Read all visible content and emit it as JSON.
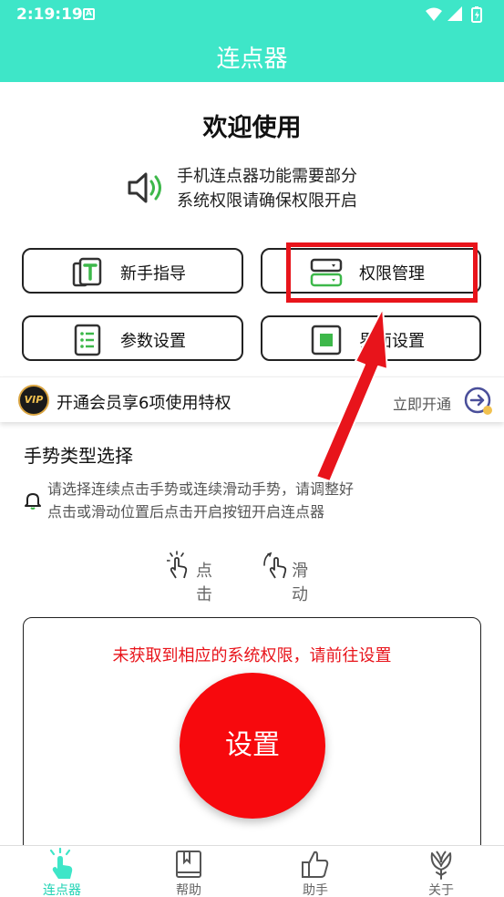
{
  "status": {
    "time": "2:19:19",
    "notif_glyph": "A"
  },
  "header": {
    "title": "连点器"
  },
  "welcome": "欢迎使用",
  "notice": {
    "line1": "手机连点器功能需要部分",
    "line2": "系统权限请确保权限开启"
  },
  "buttons": [
    {
      "label": "新手指导",
      "icon": "guide-icon"
    },
    {
      "label": "权限管理",
      "icon": "permission-icon"
    },
    {
      "label": "参数设置",
      "icon": "list-icon"
    },
    {
      "label": "界面设置",
      "icon": "interface-icon"
    }
  ],
  "vip": {
    "badge": "VIP",
    "text": "开通会员享6项使用特权",
    "action": "立即开通"
  },
  "gesture": {
    "title": "手势类型选择",
    "hint_line1": "请选择连续点击手势或连续滑动手势，请调整好",
    "hint_line2": "点击或滑动位置后点击开启按钮开启连点器",
    "tap_label": "点击",
    "swipe_label": "滑动"
  },
  "panel": {
    "warning": "未获取到相应的系统权限，请前往设置",
    "button": "设置"
  },
  "tabs": [
    {
      "label": "连点器",
      "active": true
    },
    {
      "label": "帮助",
      "active": false
    },
    {
      "label": "助手",
      "active": false
    },
    {
      "label": "关于",
      "active": false
    }
  ],
  "colors": {
    "accent": "#3ee6c8",
    "danger": "#f7090d",
    "icon_green": "#3db84a"
  }
}
